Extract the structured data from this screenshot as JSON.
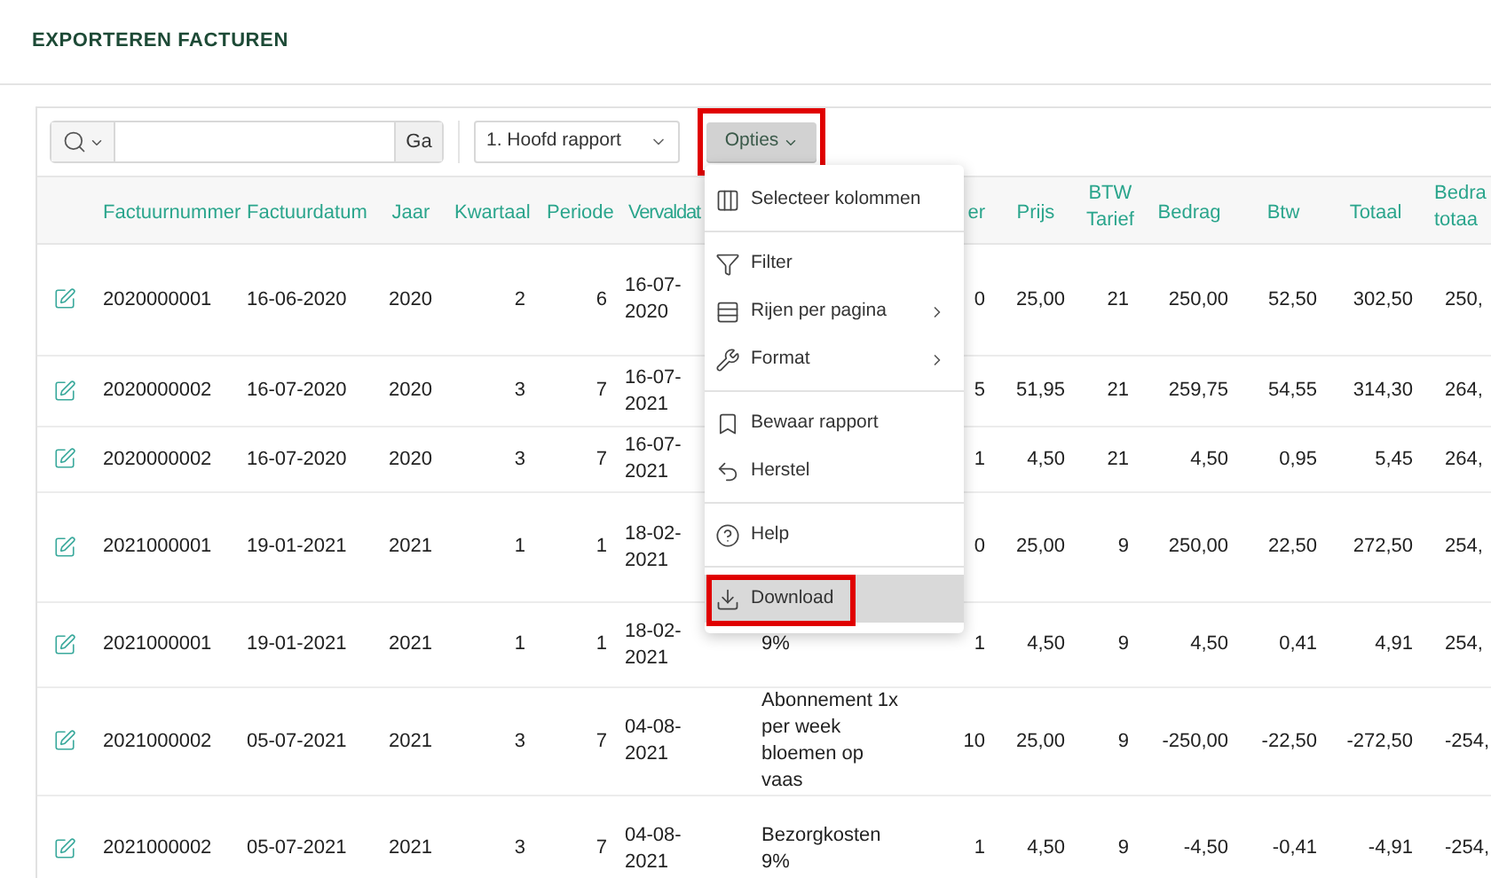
{
  "page": {
    "title": "EXPORTEREN FACTUREN"
  },
  "toolbar": {
    "go_button": "Ga",
    "report_select": "1. Hoofd rapport",
    "options_button": "Opties",
    "options_highlighted": true
  },
  "options_menu": {
    "groups": [
      [
        {
          "kind": "columns",
          "label": "Selecteer kolommen",
          "submenu": false,
          "highlighted": false
        }
      ],
      [
        {
          "kind": "filter",
          "label": "Filter",
          "submenu": false,
          "highlighted": false
        },
        {
          "kind": "rows",
          "label": "Rijen per pagina",
          "submenu": true,
          "highlighted": false
        },
        {
          "kind": "wrench",
          "label": "Format",
          "submenu": true,
          "highlighted": false
        }
      ],
      [
        {
          "kind": "bookmark",
          "label": "Bewaar rapport",
          "submenu": false,
          "highlighted": false
        },
        {
          "kind": "reset",
          "label": "Herstel",
          "submenu": false,
          "highlighted": false
        }
      ],
      [
        {
          "kind": "help",
          "label": "Help",
          "submenu": false,
          "highlighted": false
        }
      ],
      [
        {
          "kind": "download",
          "label": "Download",
          "submenu": false,
          "highlighted": true
        }
      ]
    ]
  },
  "table": {
    "columns": [
      null,
      "Factuurnummer",
      "Factuurdatum",
      "Jaar",
      "Kwartaal",
      "Periode",
      "Vervaldat",
      null,
      "er",
      "Prijs",
      "BTW Tarief",
      "Bedrag",
      "Btw",
      "Totaal",
      "Bedra totaa"
    ],
    "rows": [
      [
        null,
        "2020000001",
        "16-06-2020",
        "2020",
        "2",
        "6",
        "16-07-2020",
        null,
        "0",
        "25,00",
        "21",
        "250,00",
        "52,50",
        "302,50",
        "250,"
      ],
      [
        null,
        "2020000002",
        "16-07-2020",
        "2020",
        "3",
        "7",
        "16-07-2021",
        null,
        "5",
        "51,95",
        "21",
        "259,75",
        "54,55",
        "314,30",
        "264,"
      ],
      [
        null,
        "2020000002",
        "16-07-2020",
        "2020",
        "3",
        "7",
        "16-07-2021",
        null,
        "1",
        "4,50",
        "21",
        "4,50",
        "0,95",
        "5,45",
        "264,"
      ],
      [
        null,
        "2021000001",
        "19-01-2021",
        "2021",
        "1",
        "1",
        "18-02-2021",
        null,
        "0",
        "25,00",
        "9",
        "250,00",
        "22,50",
        "272,50",
        "254,"
      ],
      [
        null,
        "2021000001",
        "19-01-2021",
        "2021",
        "1",
        "1",
        "18-02-2021",
        "9%",
        "1",
        "4,50",
        "9",
        "4,50",
        "0,41",
        "4,91",
        "254,"
      ],
      [
        null,
        "2021000002",
        "05-07-2021",
        "2021",
        "3",
        "7",
        "04-08-2021",
        "Abonnement 1x per week bloemen op vaas",
        "10",
        "25,00",
        "9",
        "-250,00",
        "-22,50",
        "-272,50",
        "-254,"
      ],
      [
        null,
        "2021000002",
        "05-07-2021",
        "2021",
        "3",
        "7",
        "04-08-2021",
        "Bezorgkosten 9%",
        "1",
        "4,50",
        "9",
        "-4,50",
        "-0,41",
        "-4,91",
        "-254,"
      ]
    ]
  }
}
